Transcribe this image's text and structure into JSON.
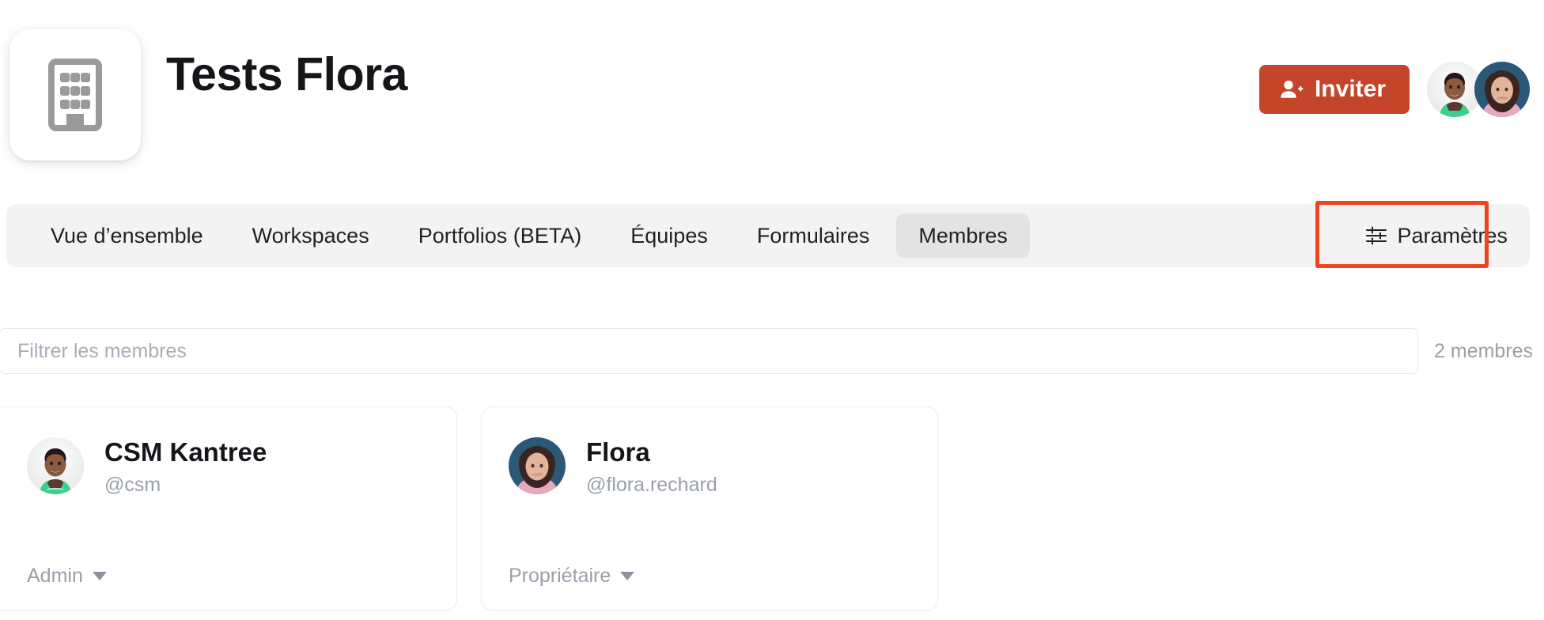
{
  "header": {
    "org_icon": "building-icon",
    "title": "Tests Flora",
    "invite_label": "Inviter",
    "invite_icon": "person-add-icon",
    "accent_color": "#c4452a",
    "avatars": [
      {
        "name": "CSM Kantree",
        "avatar": "avatar-csm"
      },
      {
        "name": "Flora",
        "avatar": "avatar-flora"
      }
    ]
  },
  "tabs": [
    {
      "id": "overview",
      "label": "Vue d’ensemble",
      "active": false
    },
    {
      "id": "workspaces",
      "label": "Workspaces",
      "active": false
    },
    {
      "id": "portfolios",
      "label": "Portfolios (BETA)",
      "active": false
    },
    {
      "id": "teams",
      "label": "Équipes",
      "active": false
    },
    {
      "id": "forms",
      "label": "Formulaires",
      "active": false
    },
    {
      "id": "members",
      "label": "Membres",
      "active": true
    }
  ],
  "settings_tab": {
    "label": "Paramètres",
    "icon": "tune-sliders-icon",
    "highlighted": true,
    "highlight_color": "#ef4423"
  },
  "filter": {
    "placeholder": "Filtrer les membres",
    "value": "",
    "count_label": "2 membres"
  },
  "members": [
    {
      "name": "CSM Kantree",
      "handle": "@csm",
      "role": "Admin",
      "avatar": "avatar-csm"
    },
    {
      "name": "Flora",
      "handle": "@flora.rechard",
      "role": "Propriétaire",
      "avatar": "avatar-flora"
    }
  ]
}
